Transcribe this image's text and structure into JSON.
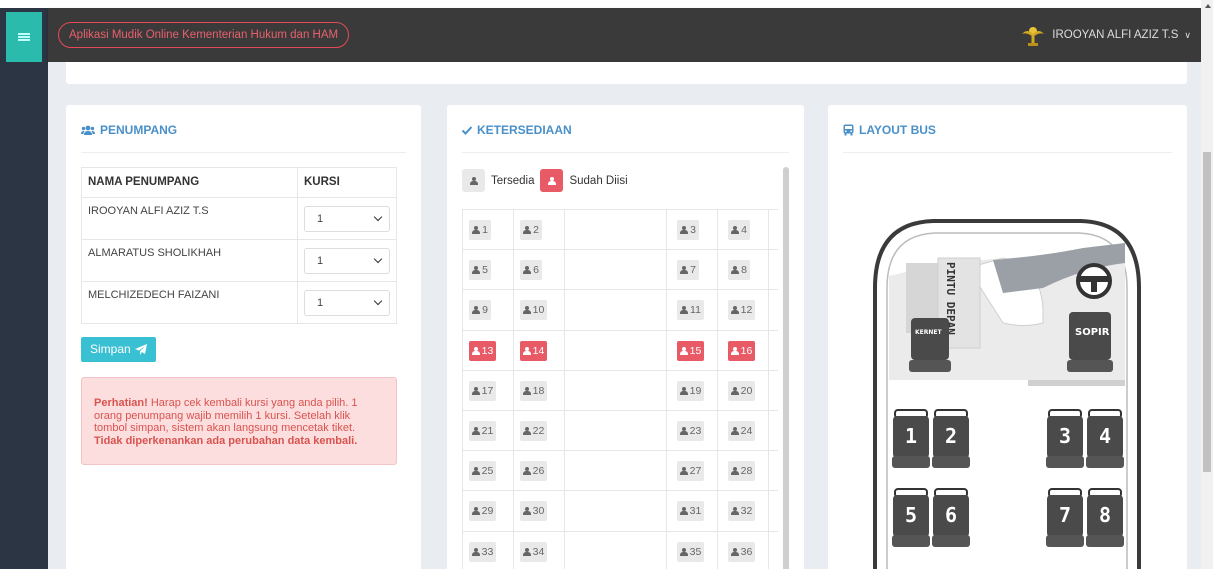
{
  "app": {
    "title": "Aplikasi Mudik Online Kementerian Hukum dan HAM"
  },
  "user": {
    "name": "IROOYAN ALFI AZIZ T.S",
    "caret": "∨"
  },
  "passengers": {
    "title": "PENUMPANG",
    "col_name": "NAMA PENUMPANG",
    "col_seat": "KURSI",
    "rows": [
      {
        "name": "IROOYAN ALFI AZIZ T.S",
        "seat": "1"
      },
      {
        "name": "ALMARATUS SHOLIKHAH",
        "seat": "1"
      },
      {
        "name": "MELCHIZEDECH FAIZANI",
        "seat": "1"
      }
    ],
    "save_label": "Simpan",
    "alert_strong": "Perhatian!",
    "alert_text": " Harap cek kembali kursi yang anda pilih. 1 orang penumpang wajib memilih 1 kursi. Setelah klik tombol simpan, sistem akan langsung mencetak tiket. ",
    "alert_strong2": "Tidak diperkenankan ada perubahan data kembali."
  },
  "availability": {
    "title": "KETERSEDIAAN",
    "legend_available": "Tersedia",
    "legend_taken": "Sudah Diisi",
    "seats": [
      [
        "1",
        "2",
        "3",
        "4"
      ],
      [
        "5",
        "6",
        "7",
        "8"
      ],
      [
        "9",
        "10",
        "11",
        "12"
      ],
      [
        "13",
        "14",
        "15",
        "16"
      ],
      [
        "17",
        "18",
        "19",
        "20"
      ],
      [
        "21",
        "22",
        "23",
        "24"
      ],
      [
        "25",
        "26",
        "27",
        "28"
      ],
      [
        "29",
        "30",
        "31",
        "32"
      ],
      [
        "33",
        "34",
        "35",
        "36"
      ]
    ],
    "taken": [
      "13",
      "14",
      "15",
      "16"
    ]
  },
  "layout": {
    "title": "LAYOUT BUS",
    "door_label": "PINTU DEPAN",
    "kernet_label": "KERNET",
    "sopir_label": "SOPIR",
    "seat_numbers": [
      "1",
      "2",
      "3",
      "4",
      "5",
      "6",
      "7",
      "8"
    ]
  },
  "colors": {
    "accent": "#4a90c8",
    "taken": "#e75a66",
    "teal": "#2bbbad",
    "header": "#3a3a3a"
  }
}
